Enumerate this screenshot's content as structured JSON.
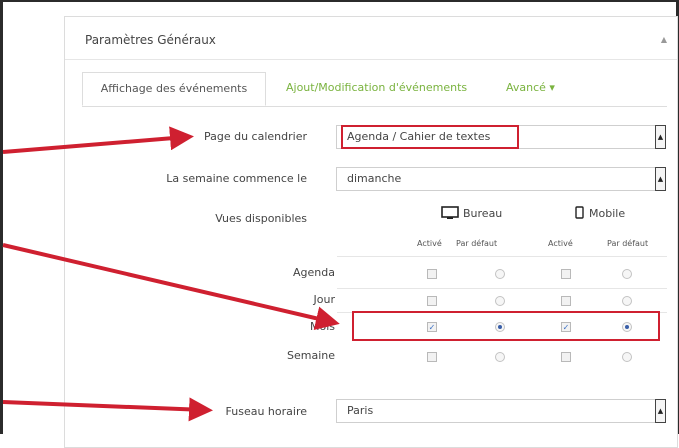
{
  "panel": {
    "title": "Paramètres Généraux",
    "collapse_icon": "caret-up-icon"
  },
  "tabs": [
    {
      "label": "Affichage des événements",
      "active": true
    },
    {
      "label": "Ajout/Modification d'événements",
      "active": false
    },
    {
      "label": "Avancé ▾",
      "active": false
    }
  ],
  "fields": {
    "calendar_page": {
      "label": "Page du calendrier",
      "value": "Agenda / Cahier de textes"
    },
    "week_start": {
      "label": "La semaine commence le",
      "value": "dimanche"
    },
    "views": {
      "label": "Vues disponibles"
    },
    "timezone": {
      "label": "Fuseau horaire",
      "value": "Paris"
    }
  },
  "views": {
    "desktop_label": "Bureau",
    "mobile_label": "Mobile",
    "desktop_icon": "monitor-icon",
    "mobile_icon": "phone-icon",
    "col_active": "Activé",
    "col_default": "Par défaut",
    "rows": [
      {
        "label": "Agenda",
        "desktop_active": false,
        "desktop_default": false,
        "mobile_active": false,
        "mobile_default": false
      },
      {
        "label": "Jour",
        "desktop_active": false,
        "desktop_default": false,
        "mobile_active": false,
        "mobile_default": false
      },
      {
        "label": "Mois",
        "desktop_active": true,
        "desktop_default": true,
        "mobile_active": true,
        "mobile_default": true
      },
      {
        "label": "Semaine",
        "desktop_active": false,
        "desktop_default": false,
        "mobile_active": false,
        "mobile_default": false
      }
    ]
  },
  "colors": {
    "annotation": "#cf2030",
    "link": "#7ab33f",
    "check": "#3a6fc4"
  }
}
